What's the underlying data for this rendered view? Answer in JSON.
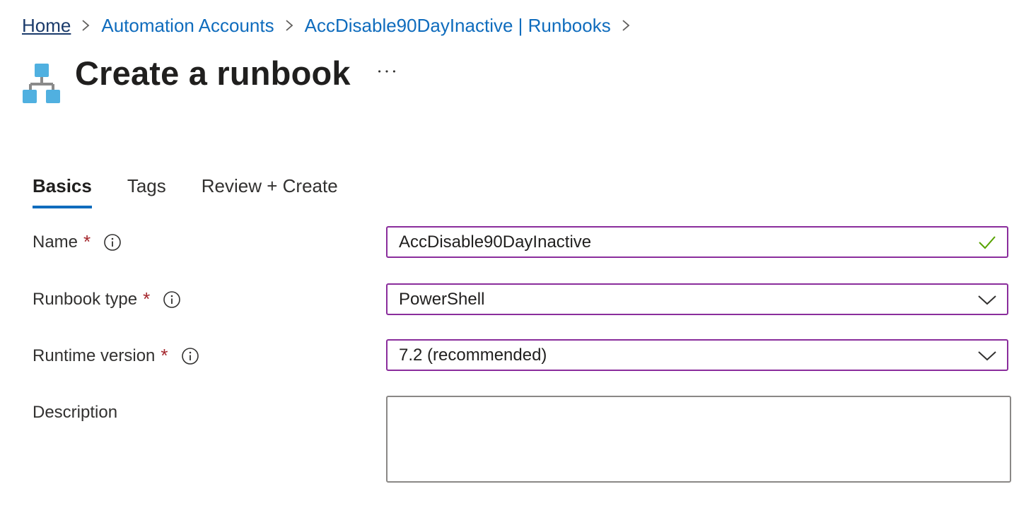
{
  "breadcrumb": {
    "items": [
      "Home",
      "Automation Accounts",
      "AccDisable90DayInactive | Runbooks"
    ]
  },
  "page": {
    "title": "Create a runbook",
    "icon": "runbook-hierarchy-icon",
    "more_label": "..."
  },
  "tabs": [
    {
      "label": "Basics",
      "active": true
    },
    {
      "label": "Tags",
      "active": false
    },
    {
      "label": "Review + Create",
      "active": false
    }
  ],
  "form": {
    "name": {
      "label": "Name",
      "required": "*",
      "value": "AccDisable90DayInactive",
      "valid": true
    },
    "runbook_type": {
      "label": "Runbook type",
      "required": "*",
      "value": "PowerShell"
    },
    "runtime_version": {
      "label": "Runtime version",
      "required": "*",
      "value": "7.2 (recommended)"
    },
    "description": {
      "label": "Description",
      "value": ""
    }
  },
  "colors": {
    "link": "#0f6cbd",
    "focus_border": "#8a2d9c",
    "required": "#a4262c",
    "valid_check": "#57a300",
    "icon_blue": "#50b0e0"
  }
}
